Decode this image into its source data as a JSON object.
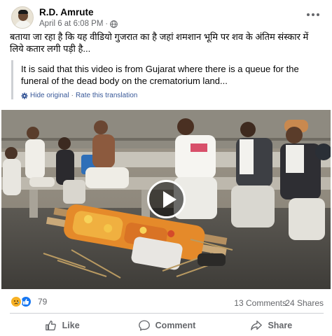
{
  "post": {
    "author": "R.D. Amrute",
    "timestamp": "April 6 at 6:08 PM",
    "text": "बताया जा रहा है कि यह वीडियो गुजरात का है जहां शमशान भूमि पर शव के अंतिम संस्कार में लिये कतार लगी पड़ी है...",
    "translation": "It is said that this video is from Gujarat where there is a queue for the funeral of the dead body on the crematorium land...",
    "hide_original": "Hide original",
    "separator": "·",
    "rate_translation": "Rate this translation"
  },
  "stats": {
    "reactions": "79",
    "comments": "13 Comments",
    "shares": "24 Shares"
  },
  "actions": {
    "like": "Like",
    "comment": "Comment",
    "share": "Share"
  },
  "icons": {
    "privacy": "globe-icon",
    "translate": "gear-icon",
    "reaction_1": "sad-icon",
    "reaction_2": "like-icon",
    "play": "play-icon",
    "more": "more-options-icon"
  },
  "colors": {
    "link": "#385898",
    "like_blue": "#1877f2",
    "secondary_text": "#65676b"
  }
}
